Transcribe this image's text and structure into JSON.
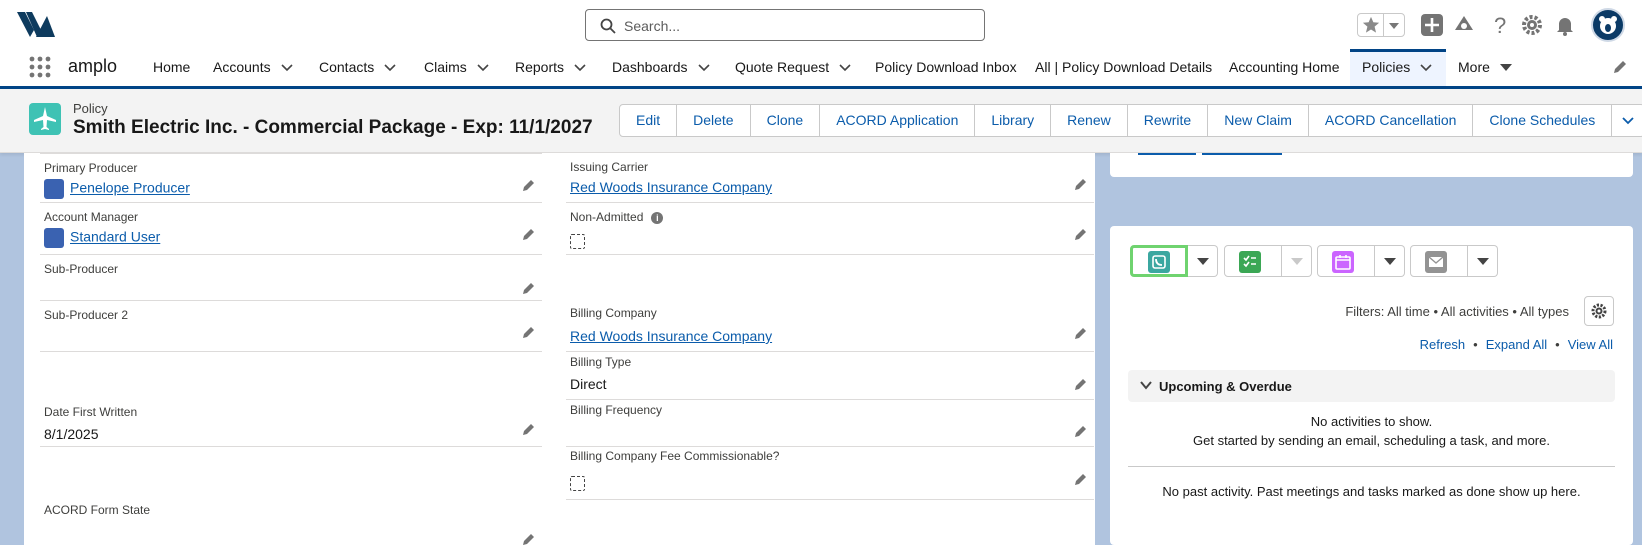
{
  "global_header": {
    "search_placeholder": "Search..."
  },
  "nav": {
    "app_name": "amplo",
    "items": [
      {
        "label": "Home",
        "has_menu": false
      },
      {
        "label": "Accounts",
        "has_menu": true
      },
      {
        "label": "Contacts",
        "has_menu": true
      },
      {
        "label": "Claims",
        "has_menu": true
      },
      {
        "label": "Reports",
        "has_menu": true
      },
      {
        "label": "Dashboards",
        "has_menu": true
      },
      {
        "label": "Quote Request",
        "has_menu": true
      },
      {
        "label": "Policy Download Inbox",
        "has_menu": false
      },
      {
        "label": "All | Policy Download Details",
        "has_menu": false
      },
      {
        "label": "Accounting Home",
        "has_menu": false
      },
      {
        "label": "Policies",
        "has_menu": true,
        "active": true
      },
      {
        "label": "More",
        "has_menu": true
      }
    ]
  },
  "record": {
    "object_type": "Policy",
    "title": "Smith Electric Inc. - Commercial Package - Exp: 11/1/2027",
    "actions": [
      "Edit",
      "Delete",
      "Clone",
      "ACORD Application",
      "Library",
      "Renew",
      "Rewrite",
      "New Claim",
      "ACORD Cancellation",
      "Clone Schedules"
    ]
  },
  "fields": {
    "primary_producer": {
      "label": "Primary Producer",
      "value": "Penelope Producer"
    },
    "issuing_carrier": {
      "label": "Issuing Carrier",
      "value": "Red Woods Insurance Company"
    },
    "account_manager": {
      "label": "Account Manager",
      "value": "Standard User"
    },
    "non_admitted": {
      "label": "Non-Admitted",
      "checked": false
    },
    "sub_producer": {
      "label": "Sub-Producer",
      "value": ""
    },
    "sub_producer_2": {
      "label": "Sub-Producer 2",
      "value": ""
    },
    "billing_company": {
      "label": "Billing Company",
      "value": "Red Woods Insurance Company"
    },
    "billing_type": {
      "label": "Billing Type",
      "value": "Direct"
    },
    "date_first_written": {
      "label": "Date First Written",
      "value": "8/1/2025"
    },
    "billing_frequency": {
      "label": "Billing Frequency",
      "value": ""
    },
    "billing_fee_commissionable": {
      "label": "Billing Company Fee Commissionable?",
      "checked": false
    },
    "acord_form_state": {
      "label": "ACORD Form State",
      "value": ""
    }
  },
  "activity": {
    "filters": "Filters: All time • All activities • All types",
    "links": {
      "refresh": "Refresh",
      "expand_all": "Expand All",
      "view_all": "View All",
      "sep": "•"
    },
    "upcoming_title": "Upcoming & Overdue",
    "no_activities_line1": "No activities to show.",
    "no_activities_line2": "Get started by sending an email, scheduling a task, and more.",
    "no_past": "No past activity. Past meetings and tasks marked as done show up here.",
    "buttons": [
      {
        "name": "log-call",
        "color": "#3ba7a0"
      },
      {
        "name": "new-task",
        "color": "#3ba755"
      },
      {
        "name": "new-event",
        "color": "#cb65ff"
      },
      {
        "name": "email",
        "color": "#939393"
      }
    ]
  },
  "colors": {
    "brand_navy": "#014486",
    "link_blue": "#0b5cab",
    "page_bg": "#b0c4df",
    "policy_icon": "#3ec2b4"
  }
}
